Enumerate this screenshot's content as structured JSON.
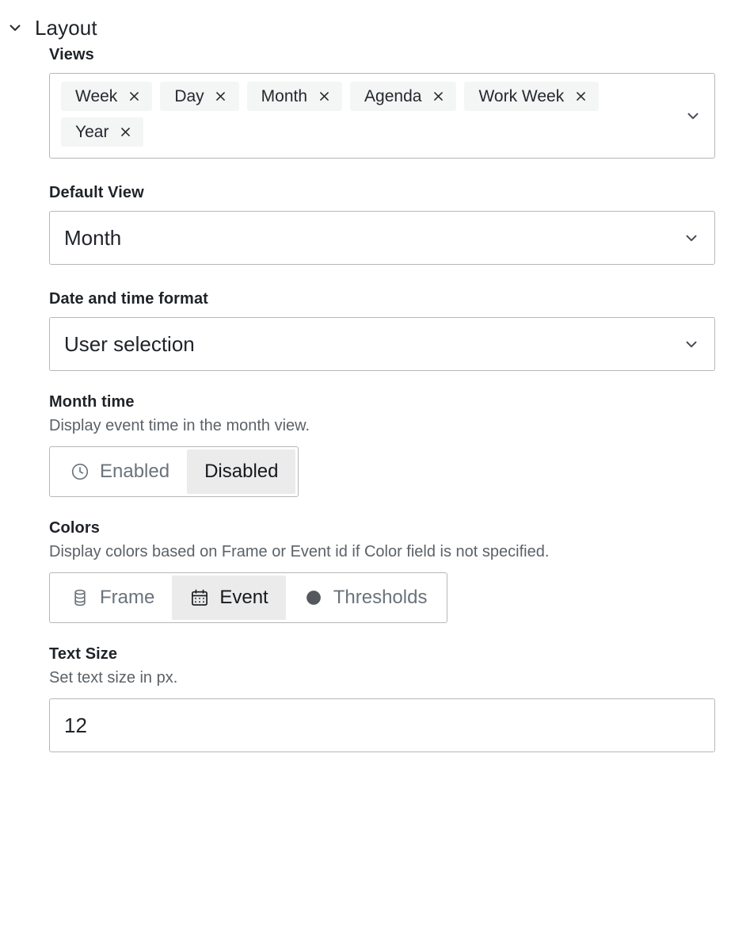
{
  "section": {
    "title": "Layout",
    "expanded": true,
    "collapse_icon": "chevron-down-icon"
  },
  "fields": {
    "views": {
      "label": "Views",
      "tags": [
        {
          "label": "Week",
          "remove_icon": "close-icon"
        },
        {
          "label": "Day",
          "remove_icon": "close-icon"
        },
        {
          "label": "Month",
          "remove_icon": "close-icon"
        },
        {
          "label": "Agenda",
          "remove_icon": "close-icon"
        },
        {
          "label": "Work Week",
          "remove_icon": "close-icon"
        },
        {
          "label": "Year",
          "remove_icon": "close-icon"
        }
      ],
      "dropdown_icon": "chevron-down-icon"
    },
    "default_view": {
      "label": "Default View",
      "value": "Month",
      "dropdown_icon": "chevron-down-icon"
    },
    "date_time_format": {
      "label": "Date and time format",
      "value": "User selection",
      "dropdown_icon": "chevron-down-icon"
    },
    "month_time": {
      "label": "Month time",
      "description": "Display event time in the month view.",
      "options": [
        {
          "label": "Enabled",
          "icon": "clock-icon",
          "selected": false
        },
        {
          "label": "Disabled",
          "icon": null,
          "selected": true
        }
      ]
    },
    "colors": {
      "label": "Colors",
      "description": "Display colors based on Frame or Event id if Color field is not specified.",
      "options": [
        {
          "label": "Frame",
          "icon": "database-icon",
          "selected": false
        },
        {
          "label": "Event",
          "icon": "calendar-icon",
          "selected": true
        },
        {
          "label": "Thresholds",
          "icon": "circle-filled-icon",
          "selected": false
        }
      ]
    },
    "text_size": {
      "label": "Text Size",
      "description": "Set text size in px.",
      "value": "12",
      "placeholder": "Auto"
    }
  },
  "colors": {
    "border": "#b4b7ba",
    "tag_bg": "#f4f5f5",
    "selected_bg": "#ebebeb",
    "text_primary": "#1f2328",
    "text_muted": "#5b6268",
    "text_radio_unselected": "#6a737b",
    "background": "#ffffff"
  }
}
